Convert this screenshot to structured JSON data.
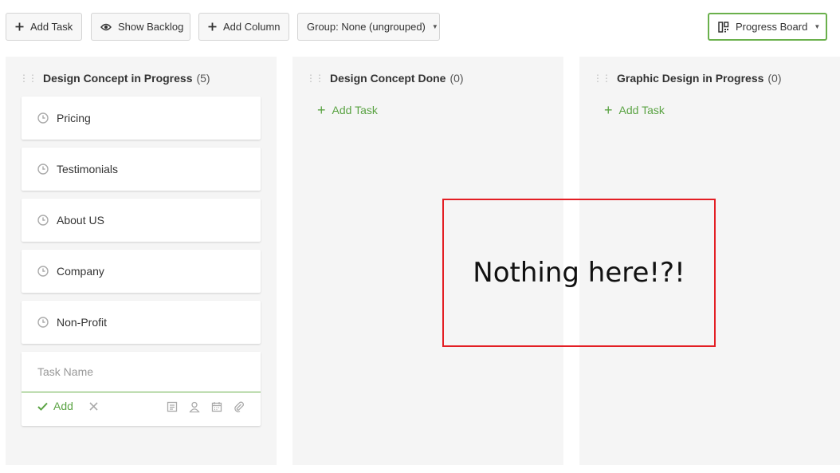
{
  "toolbar": {
    "add_task": "Add Task",
    "show_backlog": "Show Backlog",
    "add_column": "Add Column",
    "group": "Group: None (ungrouped)",
    "board": "Progress Board"
  },
  "columns": [
    {
      "title": "Design Concept in Progress",
      "count": "(5)",
      "cards": [
        "Pricing",
        "Testimonials",
        "About US",
        "Company",
        "Non-Profit"
      ]
    },
    {
      "title": "Design Concept Done",
      "count": "(0)",
      "add_label": "Add Task"
    },
    {
      "title": "Graphic Design in Progress",
      "count": "(0)",
      "add_label": "Add Task"
    }
  ],
  "new_task": {
    "placeholder": "Task Name",
    "add_label": "Add"
  },
  "annotation": {
    "text": "Nothing here!?!"
  },
  "colors": {
    "accent": "#5aa343",
    "annotation_border": "#e31e24"
  },
  "icons": {
    "toolbar": [
      "plus-icon",
      "eye-icon",
      "plus-icon",
      "caret-down-icon",
      "board-icon"
    ],
    "card": "clock-icon",
    "new_task": [
      "check-icon",
      "close-icon",
      "note-icon",
      "user-icon",
      "calendar-icon",
      "paperclip-icon"
    ]
  }
}
